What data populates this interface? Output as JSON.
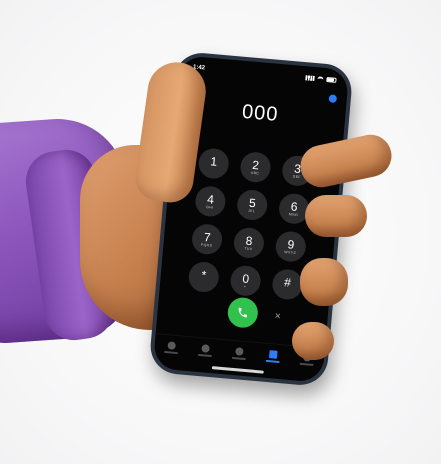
{
  "status_bar": {
    "time": "1:42"
  },
  "dialer": {
    "number": "000",
    "keys": [
      {
        "digit": "1",
        "letters": ""
      },
      {
        "digit": "2",
        "letters": "ABC"
      },
      {
        "digit": "3",
        "letters": "DEF"
      },
      {
        "digit": "4",
        "letters": "GHI"
      },
      {
        "digit": "5",
        "letters": "JKL"
      },
      {
        "digit": "6",
        "letters": "MNO"
      },
      {
        "digit": "7",
        "letters": "PQRS"
      },
      {
        "digit": "8",
        "letters": "TUV"
      },
      {
        "digit": "9",
        "letters": "WXYZ"
      },
      {
        "digit": "*",
        "letters": ""
      },
      {
        "digit": "0",
        "letters": "+"
      },
      {
        "digit": "#",
        "letters": ""
      }
    ],
    "delete_symbol": "✕"
  },
  "tabs": {
    "icons": [
      "star-icon",
      "clock-icon",
      "contacts-icon",
      "keypad-icon",
      "voicemail-icon"
    ],
    "active_index": 3
  },
  "colors": {
    "call_button": "#31c24d",
    "accent": "#2f7cf6",
    "sleeve": "#8d57bd",
    "skin": "#c6804e"
  }
}
